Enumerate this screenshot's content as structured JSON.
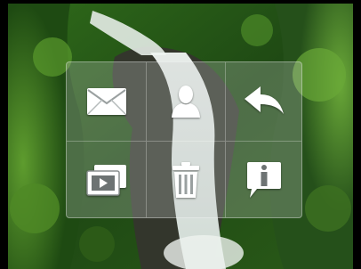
{
  "photo": {
    "subject": "waterfall-forest-photo",
    "colors": {
      "moss_dark": "#1e4a12",
      "moss_mid": "#3f7a22",
      "moss_light": "#6da43a",
      "water": "#e6eee8",
      "rock": "#3a3a30",
      "frame": "#000000"
    }
  },
  "menu": {
    "panel_color": "rgba(200,205,205,0.28)",
    "icon_color": "#ffffff",
    "items": [
      {
        "action": "share-by-email",
        "icon": "envelope-icon"
      },
      {
        "action": "assign-to-contact",
        "icon": "contact-person-icon"
      },
      {
        "action": "go-back",
        "icon": "reply-arrow-icon"
      },
      {
        "action": "slideshow",
        "icon": "slideshow-icon"
      },
      {
        "action": "delete",
        "icon": "trash-icon"
      },
      {
        "action": "info",
        "icon": "info-icon"
      }
    ]
  }
}
